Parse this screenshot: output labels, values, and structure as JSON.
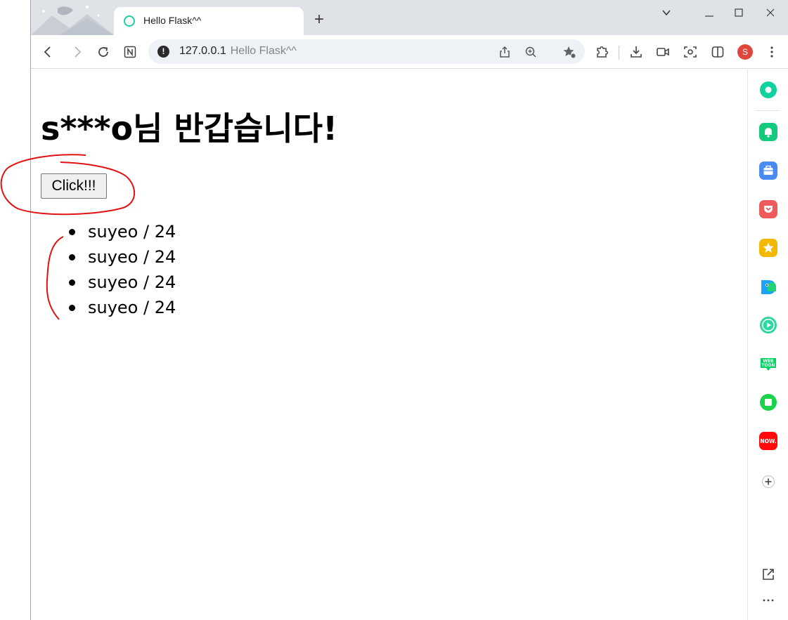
{
  "browser": {
    "tab_title": "Hello Flask^^",
    "new_tab_label": "+",
    "url_host": "127.0.0.1",
    "url_page_title": "Hello Flask^^",
    "profile_initial": "S",
    "accent": "#1ecfa5"
  },
  "page": {
    "greeting": "s***o님 반갑습니다!",
    "button_label": "Click!!!",
    "users": [
      {
        "text": "suyeo / 24"
      },
      {
        "text": "suyeo / 24"
      },
      {
        "text": "suyeo / 24"
      },
      {
        "text": "suyeo / 24"
      }
    ]
  },
  "side_panel": {
    "items": [
      {
        "icon": "whale-icon",
        "color": "#12d1a0"
      },
      {
        "icon": "bell-icon",
        "color": "#12c97c"
      },
      {
        "icon": "briefcase-icon",
        "color": "#4a8af4"
      },
      {
        "icon": "pocket-icon",
        "color": "#ef5b5b"
      },
      {
        "icon": "star-icon",
        "color": "#f5b800"
      },
      {
        "icon": "papago-icon",
        "color": "#1aa3ff"
      },
      {
        "icon": "play-icon",
        "color": "#2fd8a0"
      },
      {
        "icon": "webtoon-icon",
        "color": "#00d564"
      },
      {
        "icon": "square-icon",
        "color": "#19d34b"
      },
      {
        "icon": "now-icon",
        "color": "#ff0a0a",
        "label": "NOW."
      }
    ],
    "webtoon_label": "WEB TOON"
  },
  "annotations": {
    "color": "#e11111"
  }
}
